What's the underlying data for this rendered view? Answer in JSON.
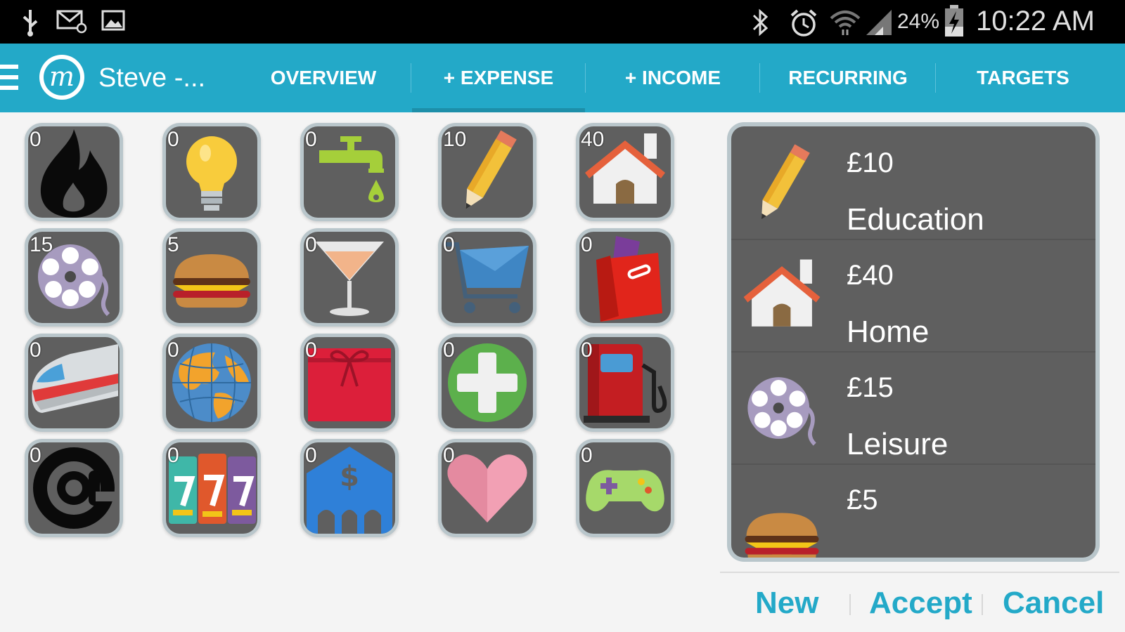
{
  "status_bar": {
    "battery": "24%",
    "time": "10:22 AM",
    "icons": [
      "usb-icon",
      "mail-icon",
      "image-icon",
      "bluetooth-icon",
      "alarm-icon",
      "wifi-icon",
      "signal-icon",
      "battery-icon"
    ]
  },
  "app_bar": {
    "title": "Steve -...",
    "tabs": [
      {
        "label": "OVERVIEW"
      },
      {
        "label": "+ EXPENSE",
        "active": true
      },
      {
        "label": "+ INCOME"
      },
      {
        "label": "RECURRING"
      },
      {
        "label": "TARGETS"
      }
    ],
    "accent": "#23a9c8"
  },
  "categories": [
    {
      "icon": "flame-icon",
      "count": "0"
    },
    {
      "icon": "lightbulb-icon",
      "count": "0"
    },
    {
      "icon": "water-tap-icon",
      "count": "0"
    },
    {
      "icon": "pencil-icon",
      "count": "10"
    },
    {
      "icon": "house-icon",
      "count": "40"
    },
    {
      "icon": "film-reel-icon",
      "count": "15"
    },
    {
      "icon": "burger-icon",
      "count": "5"
    },
    {
      "icon": "cocktail-icon",
      "count": "0"
    },
    {
      "icon": "shopping-cart-icon",
      "count": "0"
    },
    {
      "icon": "shopping-bag-icon",
      "count": "0"
    },
    {
      "icon": "train-icon",
      "count": "0"
    },
    {
      "icon": "globe-icon",
      "count": "0"
    },
    {
      "icon": "gift-icon",
      "count": "0"
    },
    {
      "icon": "medical-cross-icon",
      "count": "0"
    },
    {
      "icon": "fuel-pump-icon",
      "count": "0"
    },
    {
      "icon": "at-sign-icon",
      "count": "0"
    },
    {
      "icon": "slot-machine-icon",
      "count": "0"
    },
    {
      "icon": "bank-icon",
      "count": "0"
    },
    {
      "icon": "heart-icon",
      "count": "0"
    },
    {
      "icon": "gamepad-icon",
      "count": "0"
    }
  ],
  "selected_items": [
    {
      "icon": "pencil-icon",
      "amount": "£10",
      "category": "Education"
    },
    {
      "icon": "house-icon",
      "amount": "£40",
      "category": "Home"
    },
    {
      "icon": "film-reel-icon",
      "amount": "£15",
      "category": "Leisure"
    },
    {
      "icon": "burger-icon",
      "amount": "£5",
      "category": ""
    }
  ],
  "dialog_buttons": {
    "new": "New",
    "accept": "Accept",
    "cancel": "Cancel"
  }
}
